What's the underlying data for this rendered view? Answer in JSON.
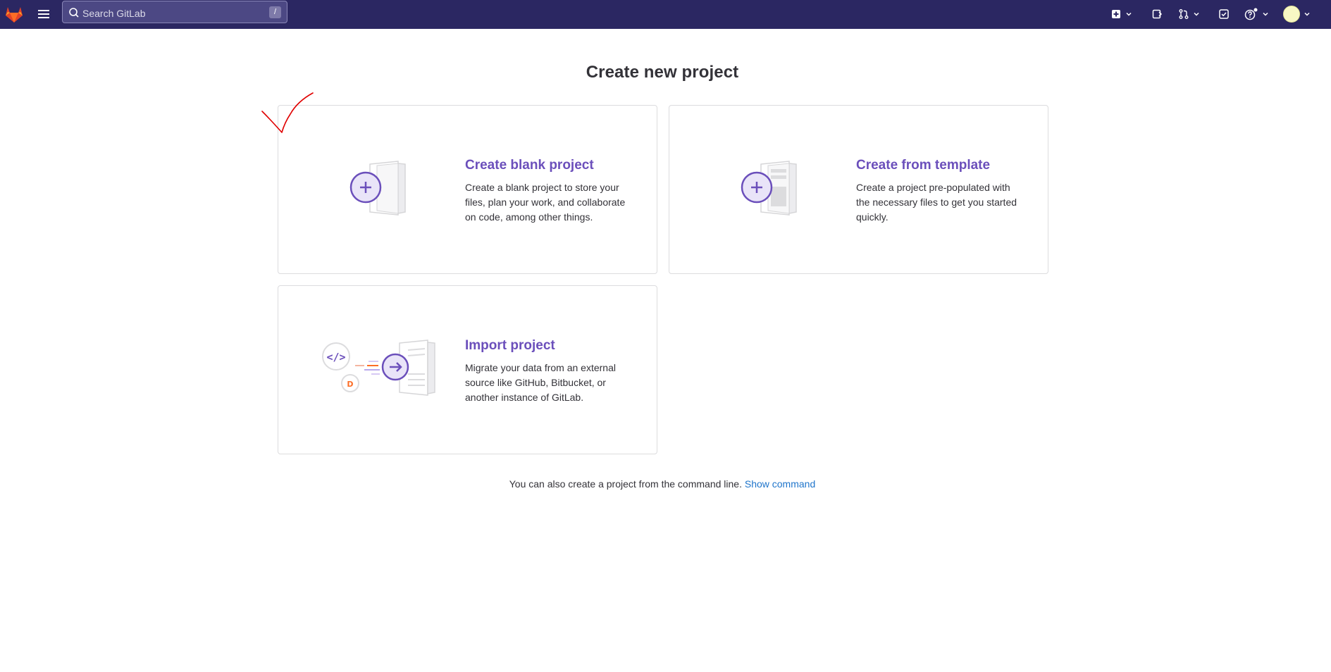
{
  "topbar": {
    "search_placeholder": "Search GitLab",
    "search_shortcut": "/",
    "icons": [
      "gitlab-logo",
      "hamburger-menu-icon",
      "search-icon",
      "create-new-icon",
      "issues-icon",
      "merge-requests-icon",
      "todos-icon",
      "help-icon",
      "user-avatar"
    ]
  },
  "page": {
    "title": "Create new project"
  },
  "cards": [
    {
      "title": "Create blank project",
      "description": "Create a blank project to store your files, plan your work, and collaborate on code, among other things."
    },
    {
      "title": "Create from template",
      "description": "Create a project pre-populated with the necessary files to get you started quickly."
    },
    {
      "title": "Import project",
      "description": "Migrate your data from an external source like GitHub, Bitbucket, or another instance of GitLab."
    }
  ],
  "cli": {
    "text": "You can also create a project from the command line.",
    "link": "Show command"
  },
  "colors": {
    "topbar": "#2b2762",
    "accent": "#6b4fbb",
    "link": "#1f75cb",
    "annotation": "#e00000"
  }
}
